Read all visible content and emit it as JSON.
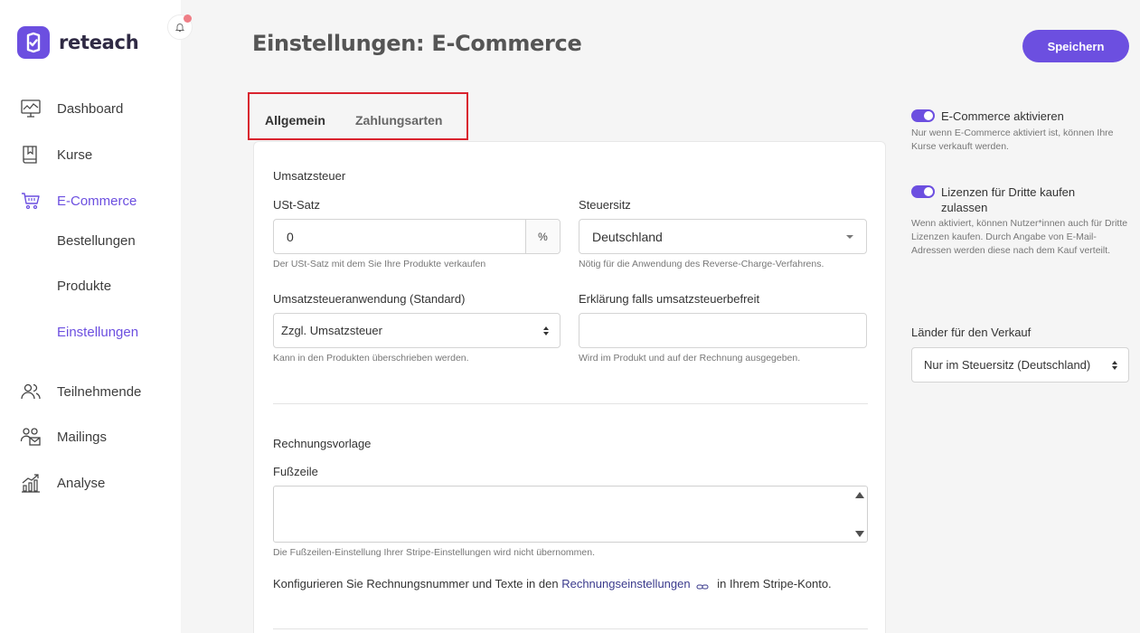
{
  "app": {
    "brand": "reteach",
    "colors": {
      "accent": "#6c4fe0",
      "highlight_box": "#d9232e",
      "notification_dot": "#ef7e86"
    }
  },
  "sidebar": {
    "items": [
      {
        "label": "Dashboard",
        "icon": "dashboard-monitor-icon"
      },
      {
        "label": "Kurse",
        "icon": "book-icon"
      },
      {
        "label": "E-Commerce",
        "icon": "shopping-cart-icon",
        "active": true
      },
      {
        "label": "Teilnehmende",
        "icon": "people-icon"
      },
      {
        "label": "Mailings",
        "icon": "people-mail-icon"
      },
      {
        "label": "Analyse",
        "icon": "analytics-chart-icon"
      }
    ],
    "subitems": [
      {
        "label": "Bestellungen"
      },
      {
        "label": "Produkte"
      },
      {
        "label": "Einstellungen",
        "active": true
      }
    ]
  },
  "header": {
    "title": "Einstellungen: E-Commerce",
    "save_label": "Speichern"
  },
  "tabs": [
    {
      "label": "Allgemein",
      "active": true
    },
    {
      "label": "Zahlungsarten",
      "active": false
    }
  ],
  "form": {
    "section_tax": "Umsatzsteuer",
    "vat_rate": {
      "label": "USt-Satz",
      "value": "0",
      "addon": "%",
      "help": "Der USt-Satz mit dem Sie Ihre Produkte verkaufen"
    },
    "tax_seat": {
      "label": "Steuersitz",
      "value": "Deutschland",
      "help": "Nötig für die Anwendung des Reverse-Charge-Verfahrens."
    },
    "tax_application": {
      "label": "Umsatzsteueranwendung (Standard)",
      "value": "Zzgl. Umsatzsteuer",
      "help": "Kann in den Produkten überschrieben werden."
    },
    "exempt_statement": {
      "label": "Erklärung falls umsatzsteuerbefreit",
      "value": "",
      "help": "Wird im Produkt und auf der Rechnung ausgegeben."
    },
    "section_invoice": "Rechnungsvorlage",
    "footer": {
      "label": "Fußzeile",
      "value": "",
      "help": "Die Fußzeilen-Einstellung Ihrer Stripe-Einstellungen wird nicht übernommen."
    },
    "config_text": {
      "before": "Konfigurieren Sie Rechnungsnummer und Texte in den",
      "link": "Rechnungseinstellungen",
      "after": "in Ihrem Stripe-Konto."
    }
  },
  "right_panel": {
    "ecommerce_toggle": {
      "label": "E-Commerce aktivieren",
      "on": true,
      "help": "Nur wenn E-Commerce aktiviert ist, können Ihre Kurse verkauft werden."
    },
    "licenses_toggle": {
      "label": "Lizenzen für Dritte kaufen zulassen",
      "on": true,
      "help": "Wenn aktiviert, können Nutzer*innen auch für Dritte Lizenzen kaufen. Durch Angabe von E-Mail-Adressen werden diese nach dem Kauf verteilt."
    },
    "countries": {
      "label": "Länder für den Verkauf",
      "value": "Nur im Steuersitz (Deutschland)"
    }
  }
}
